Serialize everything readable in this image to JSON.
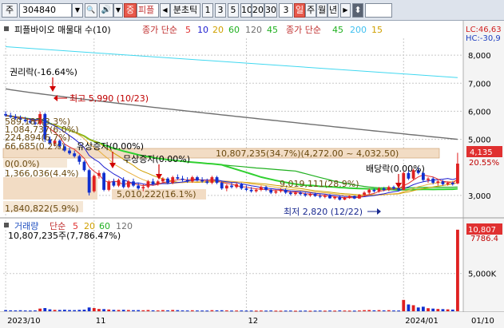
{
  "toolbar": {
    "market": "주",
    "code": "304840",
    "dropdown_glyph": "▼",
    "search_glyph": "🔍",
    "sound_glyph": "🔊",
    "sound_arrow": "▼",
    "tag_label": "중",
    "stock_name": "피플",
    "left_arrow": "◀",
    "period_label": "분초틱",
    "periods": [
      "1",
      "3",
      "5",
      "10",
      "20",
      "30"
    ],
    "count_value": "3",
    "day_label": "일",
    "week_label": "주",
    "month_label": "월",
    "year_label": "년",
    "right_arrow": "▶",
    "updown_glyph": "⬍"
  },
  "legend": {
    "title": "피플바이오 매물대 수(10)",
    "ma_prefix": "종가 단순",
    "ma_periods": [
      "5",
      "10",
      "20",
      "60",
      "120",
      "45"
    ],
    "ma_colors": [
      "#e03030",
      "#2020d0",
      "#d0a000",
      "#20b020",
      "#707070",
      "#20b020"
    ],
    "ma2_prefix": "종가 단순",
    "ma2_periods": [
      "45",
      "200",
      "15"
    ],
    "ma2_colors": [
      "#20b020",
      "#40c0f0",
      "#d0a000"
    ],
    "lc_label": "LC:46,63",
    "hc_label": "HC:-30,9"
  },
  "volume_legend": {
    "title": "거래량",
    "ma_prefix": "단순",
    "ma_periods": [
      "5",
      "20",
      "60",
      "120"
    ],
    "ma_colors": [
      "#e03030",
      "#d0a000",
      "#20b020",
      "#707070"
    ],
    "summary": "10,807,235주(7,786.47%)"
  },
  "annotations": {
    "rights_drop": "권리락(-16.64%)",
    "high": "최고 5,990 (10/23)",
    "stack1": "589,187(3.3%)",
    "stack2": "1,084,737(6.0%)",
    "stack3": "224,894(6.7%)",
    "stack4": "66,685(0.2%)",
    "paid_in": "유상증자(0.00%)",
    "free_in": "무상증자(0.00%)",
    "zero": "0(0.0%)",
    "vp1": "1,366,036(4.4%)",
    "vp2": "5,010,222(16.1%)",
    "vp3": "9,019,111(28.9%)",
    "vp4": "1,840,822(5.9%)",
    "vp_main": "10,807,235(34.7%)(4,272.00 ~ 4,032.50)",
    "dividend": "배당락(0.00%)",
    "low": "최저 2,820 (12/22)"
  },
  "price_axis": {
    "current": "4,135",
    "current_pct": "20.55%",
    "vol_current": "10,807",
    "vol_pct": "7786.4"
  },
  "chart_data": {
    "type": "candlestick",
    "price_ylim": [
      2400,
      8600
    ],
    "y_ticks": [
      {
        "label": "8,000",
        "value": 8000
      },
      {
        "label": "7,000",
        "value": 7000
      },
      {
        "label": "6,000",
        "value": 6000
      },
      {
        "label": "5,000",
        "value": 5000
      },
      {
        "label": "3,000",
        "value": 3000
      }
    ],
    "volume_ylim": [
      0,
      11000000
    ],
    "volume_ticks": [
      {
        "label": "5,000K",
        "value": 5000000
      }
    ],
    "x_labels": [
      {
        "label": "2023/10",
        "index": 0
      },
      {
        "label": "11",
        "index": 18
      },
      {
        "label": "12",
        "index": 49
      },
      {
        "label": "2024/01",
        "index": 81
      },
      {
        "label": "01/10",
        "index": 95
      }
    ],
    "candles": [
      {
        "o": 5900,
        "h": 6000,
        "l": 5800,
        "c": 5850,
        "v": 150000
      },
      {
        "o": 5850,
        "h": 5950,
        "l": 5750,
        "c": 5800,
        "v": 120000
      },
      {
        "o": 5800,
        "h": 5900,
        "l": 5700,
        "c": 5750,
        "v": 110000
      },
      {
        "o": 5750,
        "h": 5850,
        "l": 5650,
        "c": 5700,
        "v": 130000
      },
      {
        "o": 5700,
        "h": 5800,
        "l": 5600,
        "c": 5650,
        "v": 100000
      },
      {
        "o": 5650,
        "h": 5750,
        "l": 5550,
        "c": 5600,
        "v": 95000
      },
      {
        "o": 5600,
        "h": 5700,
        "l": 5500,
        "c": 5550,
        "v": 105000
      },
      {
        "o": 5550,
        "h": 5990,
        "l": 5500,
        "c": 5900,
        "v": 350000
      },
      {
        "o": 5900,
        "h": 5950,
        "l": 4900,
        "c": 5000,
        "v": 420000
      },
      {
        "o": 5000,
        "h": 5100,
        "l": 4800,
        "c": 4850,
        "v": 250000
      },
      {
        "o": 4850,
        "h": 5000,
        "l": 4750,
        "c": 4950,
        "v": 180000
      },
      {
        "o": 4950,
        "h": 5000,
        "l": 4700,
        "c": 4750,
        "v": 170000
      },
      {
        "o": 4750,
        "h": 4850,
        "l": 4550,
        "c": 4600,
        "v": 200000
      },
      {
        "o": 4600,
        "h": 4700,
        "l": 4450,
        "c": 4500,
        "v": 160000
      },
      {
        "o": 4500,
        "h": 4600,
        "l": 4350,
        "c": 4400,
        "v": 150000
      },
      {
        "o": 4400,
        "h": 4450,
        "l": 4100,
        "c": 4200,
        "v": 180000
      },
      {
        "o": 4200,
        "h": 4250,
        "l": 3850,
        "c": 3900,
        "v": 210000
      },
      {
        "o": 3900,
        "h": 3950,
        "l": 3000,
        "c": 3100,
        "v": 500000
      },
      {
        "o": 3150,
        "h": 3750,
        "l": 3100,
        "c": 3700,
        "v": 420000
      },
      {
        "o": 3700,
        "h": 3900,
        "l": 3600,
        "c": 3800,
        "v": 300000
      },
      {
        "o": 3800,
        "h": 3850,
        "l": 3150,
        "c": 3200,
        "v": 280000
      },
      {
        "o": 3200,
        "h": 3550,
        "l": 3150,
        "c": 3500,
        "v": 230000
      },
      {
        "o": 3500,
        "h": 3600,
        "l": 3300,
        "c": 3350,
        "v": 180000
      },
      {
        "o": 3350,
        "h": 3600,
        "l": 3300,
        "c": 3550,
        "v": 170000
      },
      {
        "o": 3550,
        "h": 3650,
        "l": 3250,
        "c": 3300,
        "v": 190000
      },
      {
        "o": 3300,
        "h": 3550,
        "l": 3250,
        "c": 3500,
        "v": 160000
      },
      {
        "o": 3500,
        "h": 3600,
        "l": 3300,
        "c": 3350,
        "v": 140000
      },
      {
        "o": 3350,
        "h": 3450,
        "l": 3200,
        "c": 3250,
        "v": 150000
      },
      {
        "o": 3250,
        "h": 3400,
        "l": 3150,
        "c": 3300,
        "v": 130000
      },
      {
        "o": 3300,
        "h": 3550,
        "l": 3250,
        "c": 3500,
        "v": 160000
      },
      {
        "o": 3500,
        "h": 3600,
        "l": 3350,
        "c": 3400,
        "v": 120000
      },
      {
        "o": 3400,
        "h": 3550,
        "l": 3350,
        "c": 3500,
        "v": 110000
      },
      {
        "o": 3500,
        "h": 3650,
        "l": 3450,
        "c": 3600,
        "v": 150000
      },
      {
        "o": 3600,
        "h": 3650,
        "l": 3400,
        "c": 3450,
        "v": 120000
      },
      {
        "o": 3450,
        "h": 3700,
        "l": 3400,
        "c": 3650,
        "v": 170000
      },
      {
        "o": 3650,
        "h": 3750,
        "l": 3550,
        "c": 3600,
        "v": 140000
      },
      {
        "o": 3600,
        "h": 3700,
        "l": 3500,
        "c": 3550,
        "v": 110000
      },
      {
        "o": 3550,
        "h": 3650,
        "l": 3450,
        "c": 3500,
        "v": 100000
      },
      {
        "o": 3500,
        "h": 3700,
        "l": 3450,
        "c": 3650,
        "v": 130000
      },
      {
        "o": 3650,
        "h": 3700,
        "l": 3500,
        "c": 3550,
        "v": 100000
      },
      {
        "o": 3550,
        "h": 3650,
        "l": 3450,
        "c": 3500,
        "v": 95000
      },
      {
        "o": 3500,
        "h": 3600,
        "l": 3400,
        "c": 3450,
        "v": 90000
      },
      {
        "o": 3450,
        "h": 3700,
        "l": 3400,
        "c": 3650,
        "v": 140000
      },
      {
        "o": 3650,
        "h": 3700,
        "l": 3400,
        "c": 3450,
        "v": 120000
      },
      {
        "o": 3450,
        "h": 3500,
        "l": 3200,
        "c": 3250,
        "v": 130000
      },
      {
        "o": 3250,
        "h": 3400,
        "l": 3150,
        "c": 3350,
        "v": 110000
      },
      {
        "o": 3350,
        "h": 3450,
        "l": 3250,
        "c": 3300,
        "v": 90000
      },
      {
        "o": 3300,
        "h": 3450,
        "l": 3250,
        "c": 3400,
        "v": 95000
      },
      {
        "o": 3400,
        "h": 3450,
        "l": 3200,
        "c": 3250,
        "v": 100000
      },
      {
        "o": 3250,
        "h": 3350,
        "l": 3150,
        "c": 3200,
        "v": 85000
      },
      {
        "o": 3200,
        "h": 3300,
        "l": 3100,
        "c": 3150,
        "v": 90000
      },
      {
        "o": 3150,
        "h": 3250,
        "l": 3100,
        "c": 3200,
        "v": 80000
      },
      {
        "o": 3200,
        "h": 3350,
        "l": 3150,
        "c": 3300,
        "v": 95000
      },
      {
        "o": 3300,
        "h": 3350,
        "l": 3150,
        "c": 3200,
        "v": 85000
      },
      {
        "o": 3200,
        "h": 3250,
        "l": 3050,
        "c": 3100,
        "v": 100000
      },
      {
        "o": 3100,
        "h": 3200,
        "l": 3050,
        "c": 3150,
        "v": 80000
      },
      {
        "o": 3150,
        "h": 3250,
        "l": 3100,
        "c": 3200,
        "v": 75000
      },
      {
        "o": 3200,
        "h": 3250,
        "l": 3050,
        "c": 3100,
        "v": 85000
      },
      {
        "o": 3100,
        "h": 3150,
        "l": 3000,
        "c": 3050,
        "v": 90000
      },
      {
        "o": 3050,
        "h": 3150,
        "l": 3000,
        "c": 3100,
        "v": 70000
      },
      {
        "o": 3100,
        "h": 3150,
        "l": 3000,
        "c": 3050,
        "v": 75000
      },
      {
        "o": 3050,
        "h": 3100,
        "l": 2950,
        "c": 3000,
        "v": 85000
      },
      {
        "o": 3000,
        "h": 3100,
        "l": 2950,
        "c": 3050,
        "v": 70000
      },
      {
        "o": 3050,
        "h": 3100,
        "l": 2950,
        "c": 2980,
        "v": 80000
      },
      {
        "o": 2980,
        "h": 3050,
        "l": 2900,
        "c": 2950,
        "v": 90000
      },
      {
        "o": 2950,
        "h": 3050,
        "l": 2900,
        "c": 3000,
        "v": 75000
      },
      {
        "o": 3000,
        "h": 3050,
        "l": 2880,
        "c": 2900,
        "v": 95000
      },
      {
        "o": 2900,
        "h": 2980,
        "l": 2850,
        "c": 2950,
        "v": 80000
      },
      {
        "o": 2950,
        "h": 2980,
        "l": 2820,
        "c": 2850,
        "v": 110000
      },
      {
        "o": 2850,
        "h": 2950,
        "l": 2830,
        "c": 2920,
        "v": 90000
      },
      {
        "o": 2920,
        "h": 3000,
        "l": 2880,
        "c": 2980,
        "v": 85000
      },
      {
        "o": 2980,
        "h": 3000,
        "l": 2870,
        "c": 2890,
        "v": 80000
      },
      {
        "o": 2890,
        "h": 3050,
        "l": 2880,
        "c": 3020,
        "v": 100000
      },
      {
        "o": 3020,
        "h": 3150,
        "l": 3000,
        "c": 3100,
        "v": 140000
      },
      {
        "o": 3100,
        "h": 3250,
        "l": 3050,
        "c": 3200,
        "v": 160000
      },
      {
        "o": 3200,
        "h": 3250,
        "l": 3100,
        "c": 3150,
        "v": 120000
      },
      {
        "o": 3150,
        "h": 3300,
        "l": 3100,
        "c": 3250,
        "v": 150000
      },
      {
        "o": 3250,
        "h": 3300,
        "l": 3150,
        "c": 3200,
        "v": 110000
      },
      {
        "o": 3200,
        "h": 3350,
        "l": 3150,
        "c": 3300,
        "v": 140000
      },
      {
        "o": 3300,
        "h": 3350,
        "l": 3200,
        "c": 3250,
        "v": 100000
      },
      {
        "o": 3250,
        "h": 3300,
        "l": 3150,
        "c": 3200,
        "v": 95000
      },
      {
        "o": 3200,
        "h": 3850,
        "l": 3180,
        "c": 3800,
        "v": 1500000
      },
      {
        "o": 3800,
        "h": 3900,
        "l": 3550,
        "c": 3600,
        "v": 900000
      },
      {
        "o": 3600,
        "h": 3950,
        "l": 3550,
        "c": 3900,
        "v": 800000
      },
      {
        "o": 3900,
        "h": 4000,
        "l": 3750,
        "c": 3800,
        "v": 500000
      },
      {
        "o": 3800,
        "h": 3850,
        "l": 3500,
        "c": 3550,
        "v": 600000
      },
      {
        "o": 3550,
        "h": 3650,
        "l": 3450,
        "c": 3600,
        "v": 400000
      },
      {
        "o": 3600,
        "h": 3650,
        "l": 3400,
        "c": 3450,
        "v": 350000
      },
      {
        "o": 3450,
        "h": 3550,
        "l": 3350,
        "c": 3500,
        "v": 300000
      },
      {
        "o": 3500,
        "h": 3550,
        "l": 3350,
        "c": 3400,
        "v": 280000
      },
      {
        "o": 3400,
        "h": 3500,
        "l": 3350,
        "c": 3450,
        "v": 250000
      },
      {
        "o": 3450,
        "h": 3500,
        "l": 3350,
        "c": 3400,
        "v": 220000
      },
      {
        "o": 3430,
        "h": 4520,
        "l": 3400,
        "c": 4135,
        "v": 10807235
      }
    ]
  }
}
